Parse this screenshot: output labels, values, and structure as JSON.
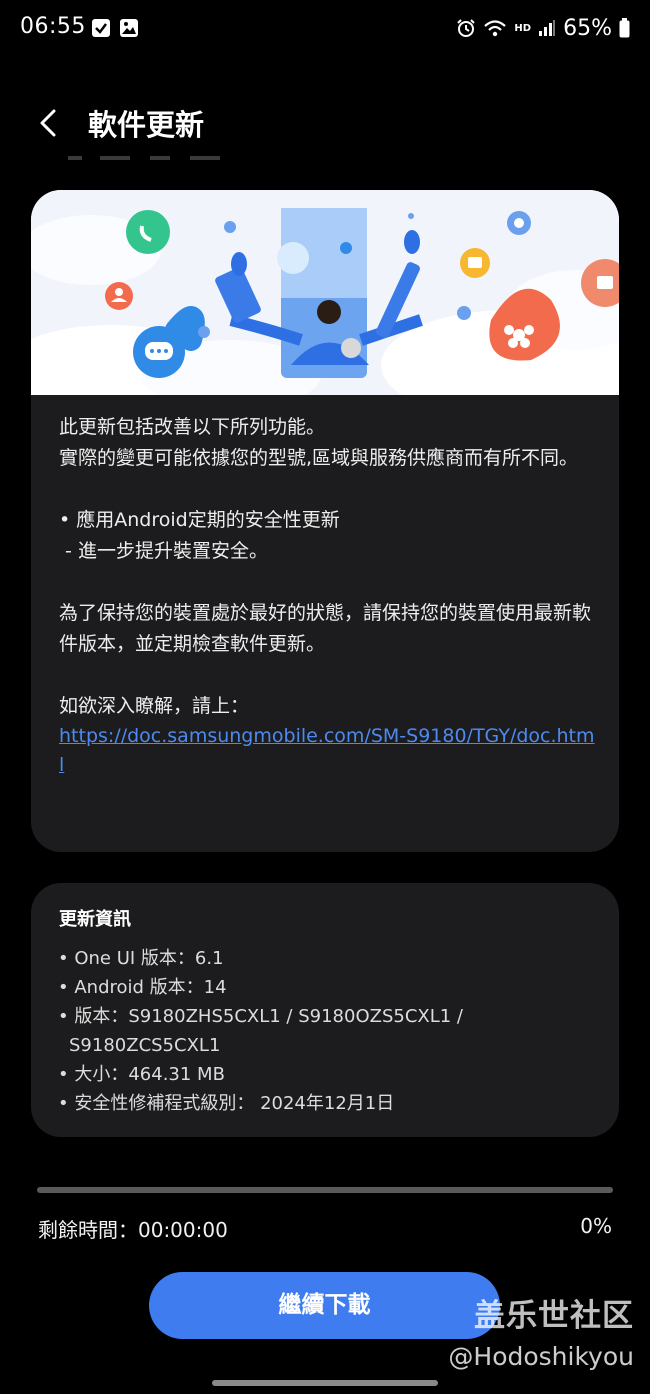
{
  "status_bar": {
    "time": "06:55",
    "hd_label": "HD",
    "battery": "65%"
  },
  "header": {
    "title": "軟件更新"
  },
  "release_notes": {
    "intro": "此更新包括改善以下所列功能。\n實際的變更可能依據您的型號,區域與服務供應商而有所不同。",
    "bullet": "• 應用Android定期的安全性更新",
    "sub_bullet": " - 進一步提升裝置安全。",
    "advice": "為了保持您的裝置處於最好的狀態，請保持您的裝置使用最新軟件版本，並定期檢查軟件更新。",
    "more_info": "如欲深入瞭解，請上：",
    "link": "https://doc.samsungmobile.com/SM-S9180/TGY/doc.html"
  },
  "update_info": {
    "title": "更新資訊",
    "items": [
      "One UI 版本：6.1",
      "Android 版本：14",
      "版本：S9180ZHS5CXL1 / S9180OZS5CXL1 / S9180ZCS5CXL1",
      "大小：464.31 MB",
      "安全性修補程式級別： 2024年12月1日"
    ]
  },
  "progress": {
    "remaining": "剩餘時間：00:00:00",
    "percent_label": "0%",
    "value": 0
  },
  "continue_button": "繼續下載",
  "watermark": {
    "title": "盖乐世社区",
    "handle": "@Hodoshikyou"
  },
  "colors": {
    "accent": "#3e7cf0",
    "link": "#4d8af0",
    "card": "#1c1c1e"
  }
}
